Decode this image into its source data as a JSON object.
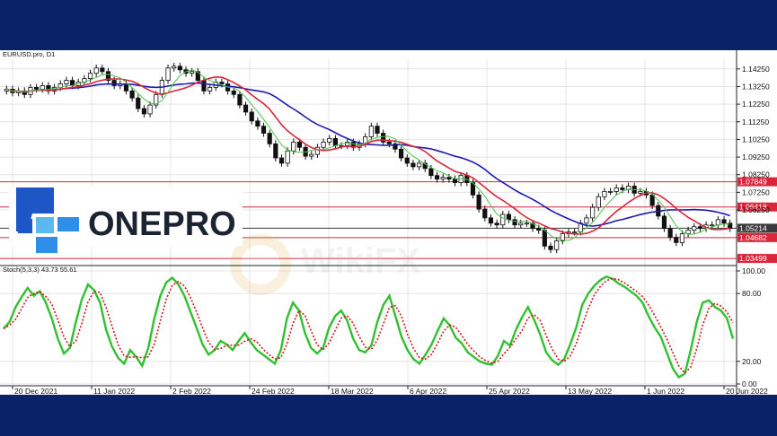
{
  "chart_data": [
    {
      "type": "candlestick",
      "title": "EURUSD.pro, D1",
      "y_ticks": [
        "1.14250",
        "1.13250",
        "1.12250",
        "1.11250",
        "1.10250",
        "1.09250",
        "1.08250",
        "1.07250",
        "1.06250"
      ],
      "x_ticks": [
        "20 Dec 2021",
        "11 Jan 2022",
        "2 Feb 2022",
        "24 Feb 2022",
        "18 Mar 2022",
        "6 Apr 2022",
        "25 Apr 2022",
        "13 May 2022",
        "1 Jun 2022",
        "20 Jun 2022"
      ],
      "ylim": [
        1.033,
        1.148
      ],
      "horizontal_levels": [
        {
          "label": "1.07849",
          "value": 1.07849,
          "color": "#d9263b"
        },
        {
          "label": "1.06418",
          "value": 1.06418,
          "color": "#d9263b"
        },
        {
          "label": "1.05214",
          "value": 1.05214,
          "color": "#3a3a3a"
        },
        {
          "label": "1.04682",
          "value": 1.04682,
          "color": "#d9263b"
        },
        {
          "label": "1.03499",
          "value": 1.03499,
          "color": "#d9263b"
        }
      ],
      "series": [
        {
          "name": "",
          "color": "#1b1bb0",
          "kind": "moving-average"
        },
        {
          "name": "",
          "color": "#d9263b",
          "kind": "moving-average"
        },
        {
          "name": "",
          "color": "#4cc44c",
          "kind": "moving-average"
        }
      ],
      "closes": [
        1.131,
        1.129,
        1.13,
        1.128,
        1.132,
        1.131,
        1.133,
        1.13,
        1.132,
        1.134,
        1.136,
        1.133,
        1.135,
        1.137,
        1.14,
        1.143,
        1.141,
        1.136,
        1.133,
        1.134,
        1.13,
        1.126,
        1.12,
        1.117,
        1.122,
        1.128,
        1.136,
        1.143,
        1.144,
        1.142,
        1.14,
        1.141,
        1.136,
        1.13,
        1.132,
        1.135,
        1.134,
        1.13,
        1.128,
        1.122,
        1.118,
        1.113,
        1.11,
        1.106,
        1.1,
        1.092,
        1.089,
        1.096,
        1.101,
        1.098,
        1.093,
        1.094,
        1.098,
        1.101,
        1.103,
        1.099,
        1.099,
        1.101,
        1.098,
        1.1,
        1.104,
        1.11,
        1.106,
        1.101,
        1.1,
        1.097,
        1.092,
        1.089,
        1.087,
        1.089,
        1.086,
        1.082,
        1.08,
        1.081,
        1.08,
        1.078,
        1.082,
        1.078,
        1.071,
        1.063,
        1.058,
        1.055,
        1.054,
        1.06,
        1.057,
        1.054,
        1.055,
        1.055,
        1.052,
        1.051,
        1.042,
        1.04,
        1.045,
        1.049,
        1.05,
        1.05,
        1.055,
        1.058,
        1.064,
        1.07,
        1.073,
        1.073,
        1.075,
        1.074,
        1.076,
        1.072,
        1.073,
        1.071,
        1.065,
        1.059,
        1.052,
        1.047,
        1.044,
        1.049,
        1.051,
        1.053,
        1.052,
        1.054,
        1.054,
        1.057,
        1.055,
        1.052
      ]
    },
    {
      "type": "line",
      "title": "Stoch(5,3,3) 43.73 55.61",
      "y_ticks": [
        "100.00",
        "80.00",
        "20.00",
        "0.00"
      ],
      "ylim": [
        0,
        100
      ],
      "series": [
        {
          "name": "",
          "color": "#30c030",
          "kind": "main"
        },
        {
          "name": "",
          "color": "#d01818",
          "kind": "signal"
        }
      ],
      "k": [
        49,
        55,
        68,
        77,
        85,
        78,
        82,
        72,
        58,
        40,
        27,
        32,
        55,
        75,
        88,
        83,
        72,
        48,
        33,
        23,
        18,
        30,
        24,
        16,
        32,
        58,
        78,
        90,
        94,
        88,
        78,
        64,
        50,
        35,
        26,
        30,
        38,
        35,
        30,
        38,
        45,
        37,
        30,
        26,
        22,
        18,
        30,
        58,
        72,
        65,
        45,
        32,
        27,
        32,
        50,
        60,
        65,
        56,
        40,
        30,
        28,
        34,
        55,
        70,
        78,
        60,
        42,
        30,
        22,
        18,
        26,
        35,
        47,
        58,
        52,
        41,
        36,
        28,
        24,
        20,
        18,
        17,
        25,
        38,
        34,
        48,
        59,
        68,
        57,
        44,
        28,
        21,
        17,
        22,
        35,
        50,
        70,
        80,
        87,
        92,
        95,
        93,
        89,
        86,
        82,
        78,
        72,
        60,
        50,
        42,
        28,
        14,
        6,
        9,
        30,
        55,
        72,
        74,
        68,
        65,
        58,
        40
      ]
    }
  ],
  "watermark_text": "WikiFX",
  "logo_text": "ONEPRO"
}
